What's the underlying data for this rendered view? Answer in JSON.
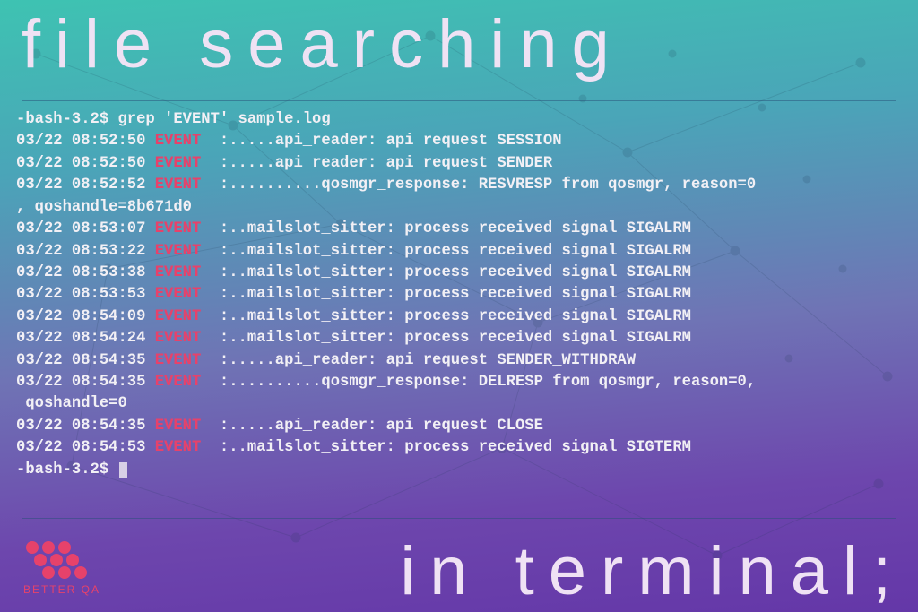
{
  "heading_top": "file searching",
  "heading_bottom": "in terminal;",
  "brand_name": "BETTER QA",
  "colors": {
    "highlight": "#e6426b",
    "text": "#f2f0f5"
  },
  "terminal": {
    "prompt": "-bash-3.2$",
    "command": "grep 'EVENT' sample.log",
    "highlight_token": "EVENT",
    "lines": [
      {
        "type": "cmd",
        "prompt": "-bash-3.2$ ",
        "text": "grep 'EVENT' sample.log"
      },
      {
        "type": "out",
        "pre": "03/22 08:52:50 ",
        "hl": "EVENT",
        "post": "  :.....api_reader: api request SESSION"
      },
      {
        "type": "out",
        "pre": "03/22 08:52:50 ",
        "hl": "EVENT",
        "post": "  :.....api_reader: api request SENDER"
      },
      {
        "type": "out",
        "pre": "03/22 08:52:52 ",
        "hl": "EVENT",
        "post": "  :..........qosmgr_response: RESVRESP from qosmgr, reason=0"
      },
      {
        "type": "plain",
        "text": ", qoshandle=8b671d0"
      },
      {
        "type": "out",
        "pre": "03/22 08:53:07 ",
        "hl": "EVENT",
        "post": "  :..mailslot_sitter: process received signal SIGALRM"
      },
      {
        "type": "out",
        "pre": "03/22 08:53:22 ",
        "hl": "EVENT",
        "post": "  :..mailslot_sitter: process received signal SIGALRM"
      },
      {
        "type": "out",
        "pre": "03/22 08:53:38 ",
        "hl": "EVENT",
        "post": "  :..mailslot_sitter: process received signal SIGALRM"
      },
      {
        "type": "out",
        "pre": "03/22 08:53:53 ",
        "hl": "EVENT",
        "post": "  :..mailslot_sitter: process received signal SIGALRM"
      },
      {
        "type": "out",
        "pre": "03/22 08:54:09 ",
        "hl": "EVENT",
        "post": "  :..mailslot_sitter: process received signal SIGALRM"
      },
      {
        "type": "out",
        "pre": "03/22 08:54:24 ",
        "hl": "EVENT",
        "post": "  :..mailslot_sitter: process received signal SIGALRM"
      },
      {
        "type": "out",
        "pre": "03/22 08:54:35 ",
        "hl": "EVENT",
        "post": "  :.....api_reader: api request SENDER_WITHDRAW"
      },
      {
        "type": "out",
        "pre": "03/22 08:54:35 ",
        "hl": "EVENT",
        "post": "  :..........qosmgr_response: DELRESP from qosmgr, reason=0,"
      },
      {
        "type": "plain",
        "text": " qoshandle=0"
      },
      {
        "type": "out",
        "pre": "03/22 08:54:35 ",
        "hl": "EVENT",
        "post": "  :.....api_reader: api request CLOSE"
      },
      {
        "type": "out",
        "pre": "03/22 08:54:53 ",
        "hl": "EVENT",
        "post": "  :..mailslot_sitter: process received signal SIGTERM"
      },
      {
        "type": "prompt",
        "prompt": "-bash-3.2$ "
      }
    ]
  }
}
